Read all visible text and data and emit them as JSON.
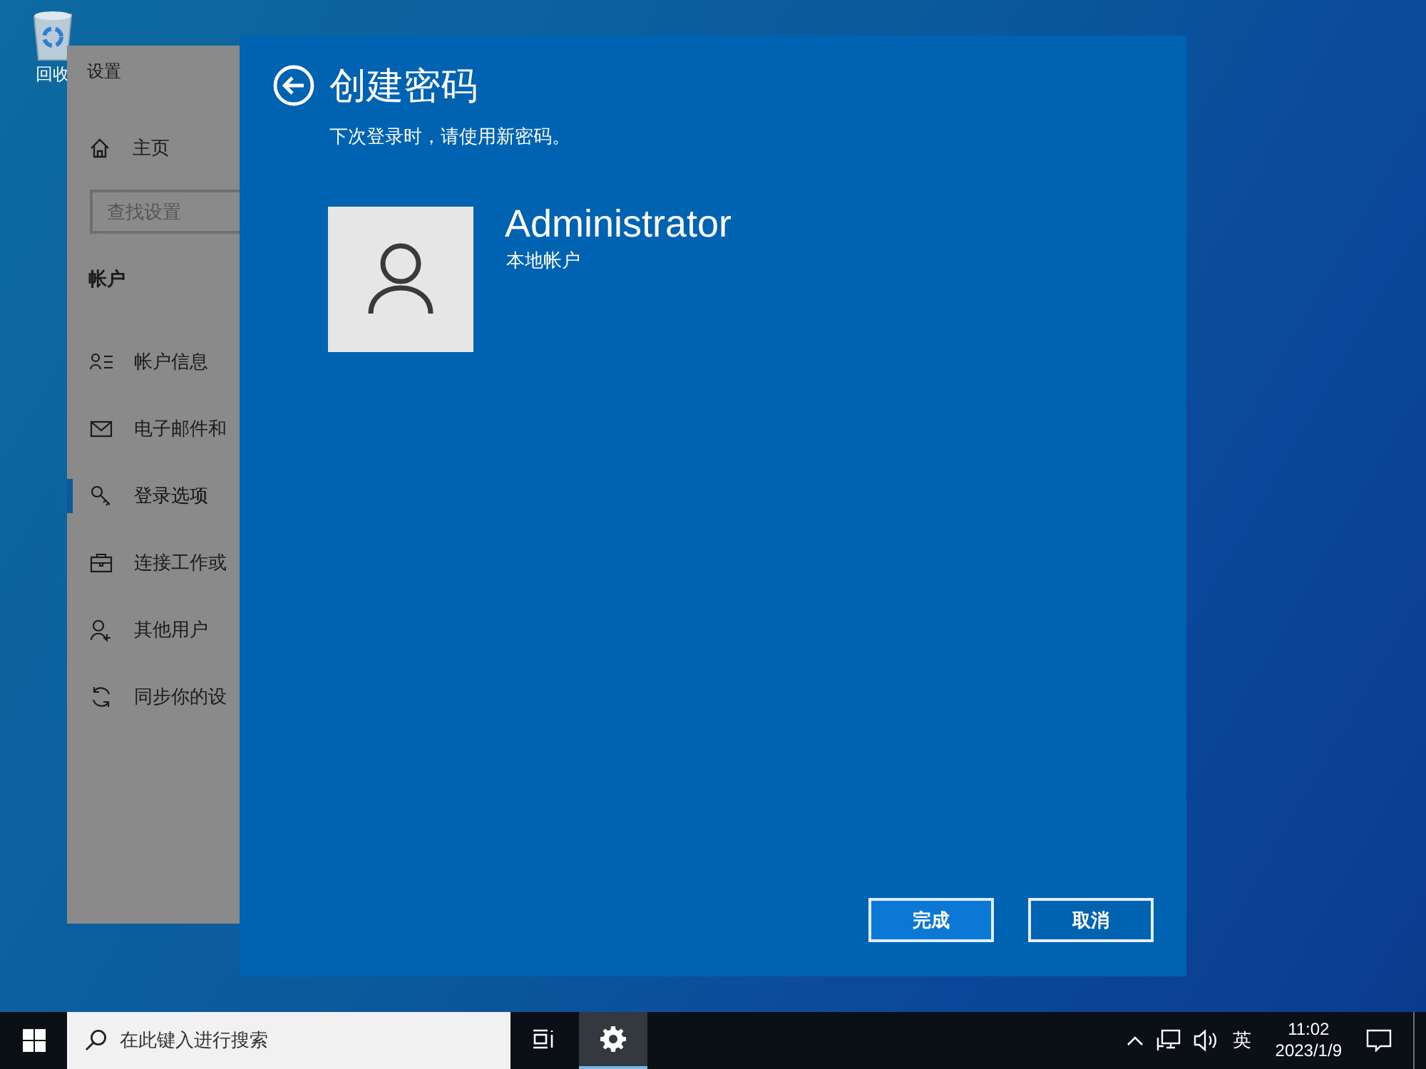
{
  "desktop": {
    "icons": [
      {
        "label": "回收"
      }
    ]
  },
  "settings_window": {
    "title": "设置",
    "home": "主页",
    "search": {
      "placeholder": "查找设置"
    },
    "section": "帐户",
    "items": [
      {
        "label": "帐户信息",
        "kind": "person-list",
        "selected": false
      },
      {
        "label": "电子邮件和",
        "kind": "mail",
        "selected": false
      },
      {
        "label": "登录选项",
        "kind": "key",
        "selected": true
      },
      {
        "label": "连接工作或",
        "kind": "briefcase",
        "selected": false
      },
      {
        "label": "其他用户",
        "kind": "person-add",
        "selected": false
      },
      {
        "label": "同步你的设",
        "kind": "sync",
        "selected": false
      }
    ]
  },
  "dialog": {
    "title": "创建密码",
    "subtitle": "下次登录时，请使用新密码。",
    "account": {
      "name": "Administrator",
      "type": "本地帐户"
    },
    "buttons": [
      {
        "label": "完成",
        "kind": "primary"
      },
      {
        "label": "取消",
        "kind": "secondary"
      }
    ]
  },
  "taskbar": {
    "search": {
      "placeholder": "在此键入进行搜索"
    },
    "apps": [
      {
        "kind": "task-view",
        "active": false
      },
      {
        "kind": "settings",
        "active": true
      }
    ],
    "tray": {
      "ime": "英",
      "time": "11:02",
      "date": "2023/1/9"
    }
  }
}
